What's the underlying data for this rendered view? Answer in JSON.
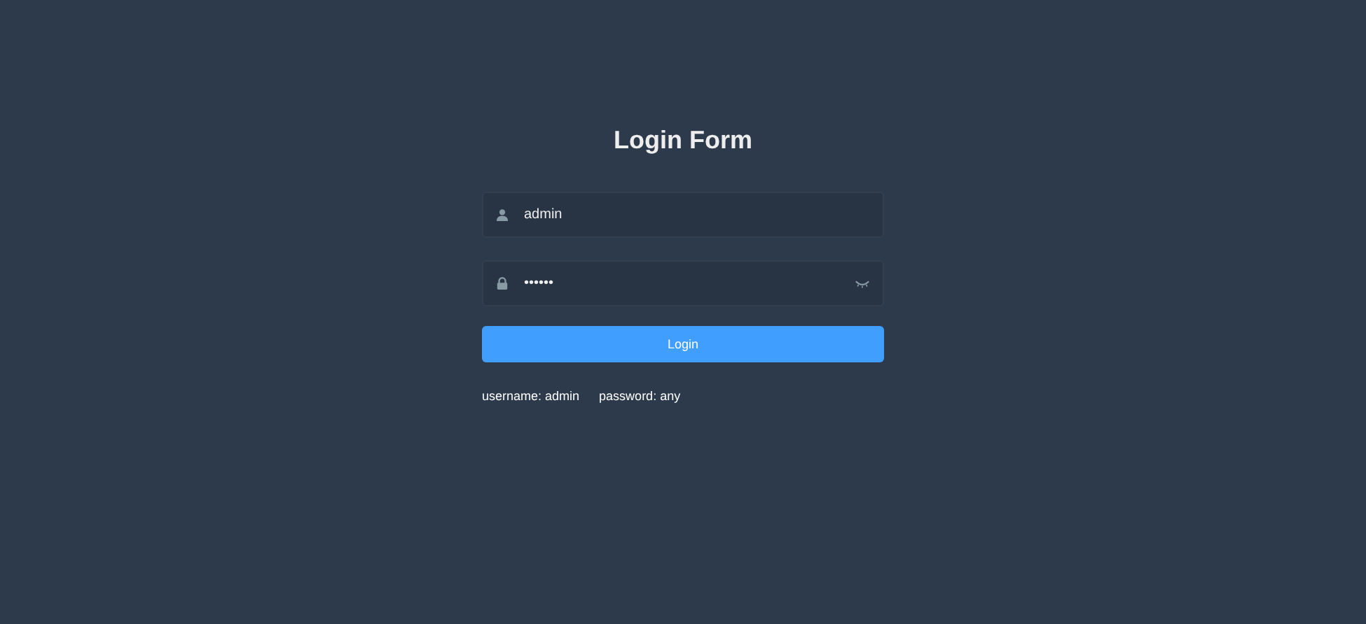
{
  "title": "Login Form",
  "fields": [
    {
      "kind": "user",
      "value": "admin"
    },
    {
      "kind": "password",
      "value": "••••••"
    }
  ],
  "button": "Login",
  "tips": [
    "username: admin",
    "password: any"
  ]
}
